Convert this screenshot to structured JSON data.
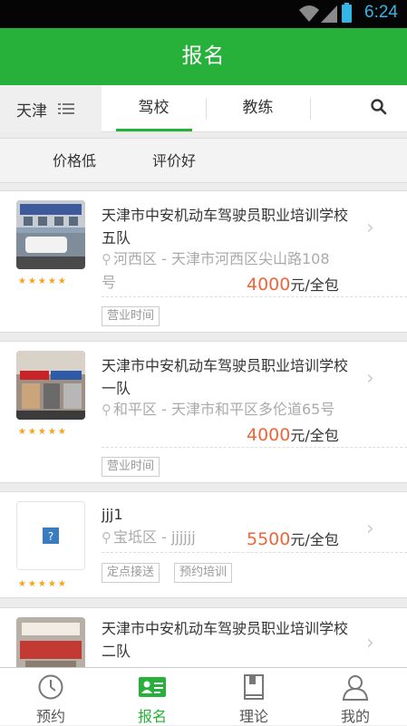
{
  "status": {
    "time": "6:24"
  },
  "title": "报名",
  "city": "天津",
  "tabs": [
    {
      "label": "驾校",
      "active": true
    },
    {
      "label": "教练",
      "active": false
    }
  ],
  "filters": [
    "价格低",
    "评价好"
  ],
  "schools": [
    {
      "name": "天津市中安机动车驾驶员职业培训学校五队",
      "district": "河西区",
      "address": "天津市河西区尖山路108号",
      "price": "4000",
      "price_unit": "元/全包",
      "stars": "★★★★★",
      "tags": [
        "营业时间"
      ]
    },
    {
      "name": "天津市中安机动车驾驶员职业培训学校一队",
      "district": "和平区",
      "address": "天津市和平区多伦道65号",
      "price": "4000",
      "price_unit": "元/全包",
      "stars": "★★★★★",
      "tags": [
        "营业时间"
      ]
    },
    {
      "name": "jjj1",
      "district": "宝坻区",
      "address": "jjjjjj",
      "price": "5500",
      "price_unit": "元/全包",
      "stars": "★★★★★",
      "tags": [
        "定点接送",
        "预约培训"
      ]
    },
    {
      "name": "天津市中安机动车驾驶员职业培训学校二队",
      "district": "",
      "address": "",
      "price": "",
      "price_unit": "",
      "stars": "",
      "tags": []
    }
  ],
  "nav": [
    {
      "label": "预约",
      "icon": "clock-icon"
    },
    {
      "label": "报名",
      "icon": "id-card-icon",
      "active": true
    },
    {
      "label": "理论",
      "icon": "book-icon"
    },
    {
      "label": "我的",
      "icon": "user-icon"
    }
  ],
  "colors": {
    "brand": "#27b03a",
    "price": "#f0653a",
    "star": "#f7a21b",
    "status_accent": "#33b5e5"
  }
}
